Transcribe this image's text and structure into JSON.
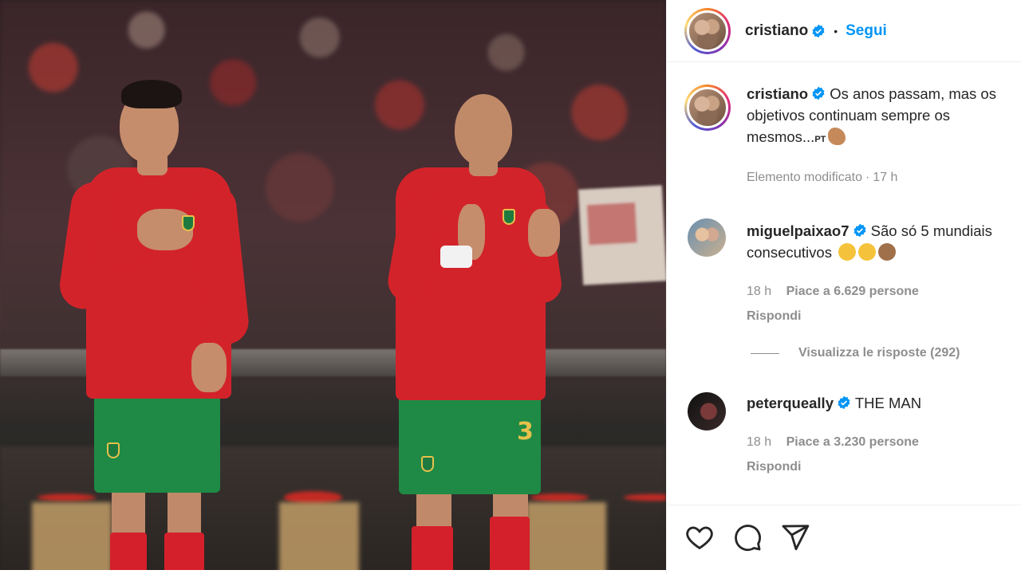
{
  "post": {
    "author": "cristiano",
    "follow_label": "Segui",
    "separator": "•",
    "caption": "Os anos passam, mas os objetivos continuam sempre os mesmos...",
    "caption_suffix": "PT",
    "edited_label": "Elemento modificato",
    "edited_time": "17 h",
    "meta_separator": "·"
  },
  "comments": [
    {
      "username": "miguelpaixao7",
      "text": "São só 5 mundiais consecutivos",
      "time": "18 h",
      "likes": "Piace a 6.629 persone",
      "reply_label": "Rispondi",
      "view_replies": "Visualizza le risposte (292)"
    },
    {
      "username": "peterqueally",
      "text": "THE MAN",
      "time": "18 h",
      "likes": "Piace a 3.230 persone",
      "reply_label": "Rispondi"
    }
  ],
  "actions": {
    "icons": [
      "heart-icon",
      "comment-icon",
      "share-icon"
    ]
  },
  "colors": {
    "link": "#0095f6",
    "muted": "#8e8e8e",
    "text": "#262626",
    "jersey_red": "#d3232a",
    "shorts_green": "#1f8a45"
  },
  "photo": {
    "jersey_number": "3"
  }
}
